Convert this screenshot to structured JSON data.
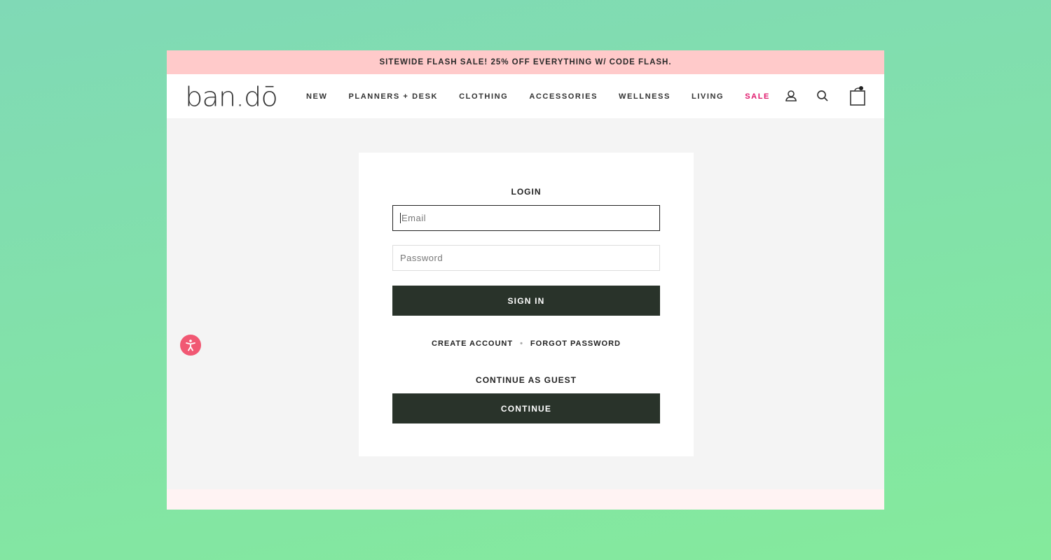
{
  "banner": {
    "text": "SITEWIDE FLASH SALE! 25% OFF EVERYTHING W/ CODE FLASH."
  },
  "header": {
    "logo": "ban.dō",
    "menu": [
      "NEW",
      "PLANNERS + DESK",
      "CLOTHING",
      "ACCESSORIES",
      "WELLNESS",
      "LIVING",
      "SALE"
    ],
    "sale_color": "#e0186c"
  },
  "login": {
    "title": "LOGIN",
    "email_placeholder": "Email",
    "password_placeholder": "Password",
    "sign_in": "SIGN IN",
    "create_account": "CREATE ACCOUNT",
    "forgot_password": "FORGOT PASSWORD",
    "guest_title": "CONTINUE AS GUEST",
    "continue": "CONTINUE"
  },
  "colors": {
    "button": "#29332a",
    "banner": "#ffcaca",
    "accessibility": "#f15873"
  }
}
